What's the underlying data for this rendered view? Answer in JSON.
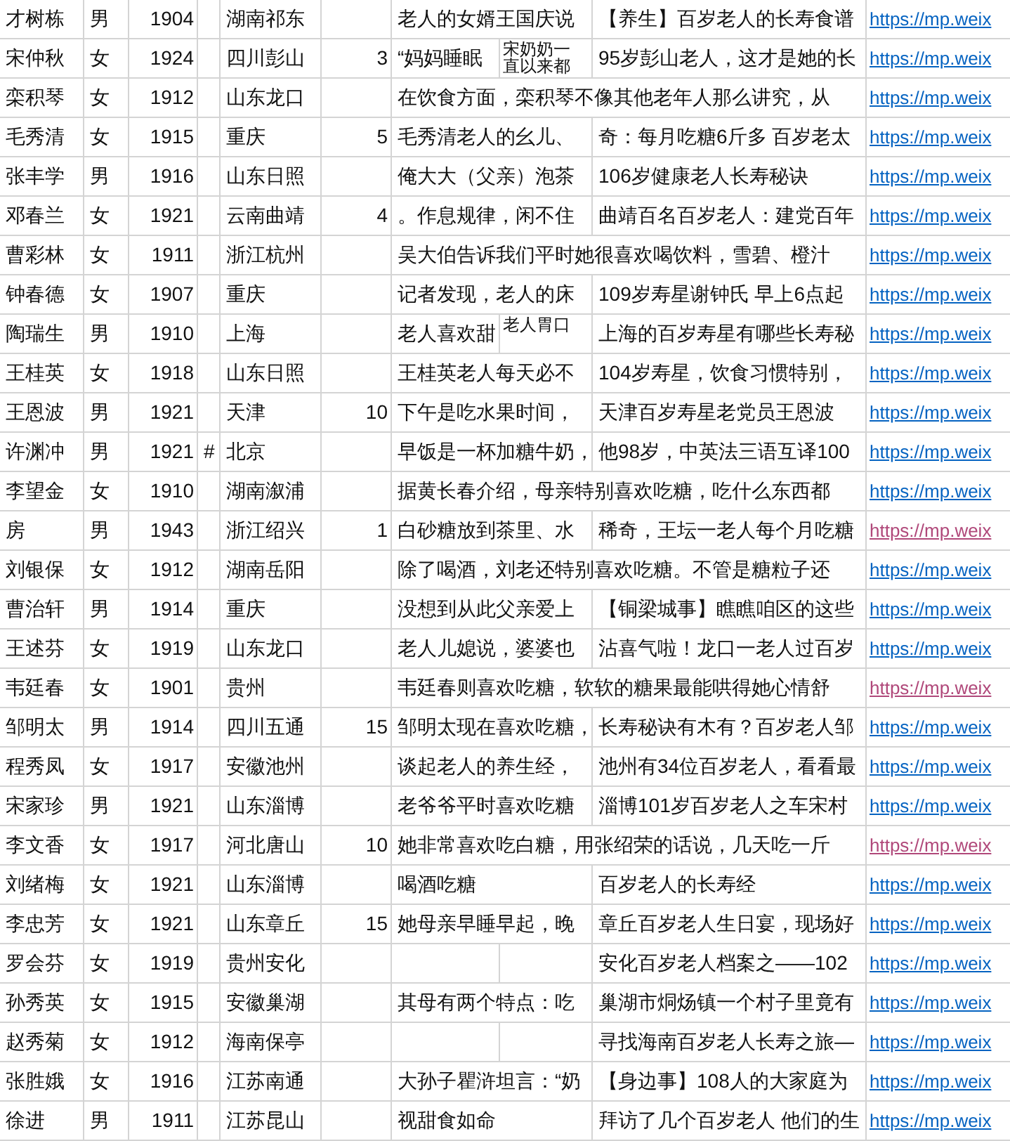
{
  "rows": [
    {
      "column_1": "才树栋",
      "column_2": "男",
      "column_3": "1904",
      "column_5": "湖南祁东",
      "column_7": "老人的女婿王国庆说",
      "column_9": "【养生】百岁老人的长寿食谱",
      "column_10": "https://mp.weix",
      "visited": false
    },
    {
      "column_1": "宋仲秋",
      "column_2": "女",
      "column_3": "1924",
      "column_5": "四川彭山",
      "column_6": "3",
      "column_7": "“妈妈睡眠",
      "column_8": "宋奶奶一直以来都",
      "column_9": "95岁彭山老人，这才是她的长",
      "column_10": "https://mp.weix",
      "visited": false
    },
    {
      "column_1": "栾积琴",
      "column_2": "女",
      "column_3": "1912",
      "column_5": "山东龙口",
      "column_7": "在饮食方面，栾积琴不像其他老年人那么讲究，从",
      "column_10": "https://mp.weix",
      "visited": false
    },
    {
      "column_1": "毛秀清",
      "column_2": "女",
      "column_3": "1915",
      "column_5": "重庆",
      "column_6": "5",
      "column_7": "毛秀清老人的幺儿、",
      "column_9": "奇：每月吃糖6斤多 百岁老太",
      "column_10": "https://mp.weix",
      "visited": false
    },
    {
      "column_1": "张丰学",
      "column_2": "男",
      "column_3": "1916",
      "column_5": "山东日照",
      "column_7": "俺大大（父亲）泡茶",
      "column_9": "106岁健康老人长寿秘诀",
      "column_10": "https://mp.weix",
      "visited": false
    },
    {
      "column_1": "邓春兰",
      "column_2": "女",
      "column_3": "1921",
      "column_5": "云南曲靖",
      "column_6": "4",
      "column_7": "。作息规律，闲不住",
      "column_9": "曲靖百名百岁老人：建党百年",
      "column_10": "https://mp.weix",
      "visited": false
    },
    {
      "column_1": "曹彩林",
      "column_2": "女",
      "column_3": "1911",
      "column_5": "浙江杭州",
      "column_7": "吴大伯告诉我们平时她很喜欢喝饮料，雪碧、橙汁",
      "column_10": "https://mp.weix",
      "visited": false
    },
    {
      "column_1": "钟春德",
      "column_2": "女",
      "column_3": "1907",
      "column_5": "重庆",
      "column_7": "记者发现，老人的床",
      "column_9": "109岁寿星谢钟氏 早上6点起",
      "column_10": "https://mp.weix",
      "visited": false
    },
    {
      "column_1": "陶瑞生",
      "column_2": "男",
      "column_3": "1910",
      "column_5": "上海",
      "column_7": "老人喜欢甜",
      "column_8": "老人胃口",
      "column_9": "上海的百岁寿星有哪些长寿秘",
      "column_10": "https://mp.weix",
      "visited": false
    },
    {
      "column_1": "王桂英",
      "column_2": "女",
      "column_3": "1918",
      "column_5": "山东日照",
      "column_7": "王桂英老人每天必不",
      "column_9": "104岁寿星，饮食习惯特别，",
      "column_10": "https://mp.weix",
      "visited": false
    },
    {
      "column_1": "王恩波",
      "column_2": "男",
      "column_3": "1921",
      "column_5": "天津",
      "column_6": "10",
      "column_7": "下午是吃水果时间，",
      "column_9": "天津百岁寿星老党员王恩波",
      "column_10": "https://mp.weix",
      "visited": false
    },
    {
      "column_1": "许渊冲",
      "column_2": "男",
      "column_3": "1921",
      "column_4": "#",
      "column_5": "北京",
      "column_7": "早饭是一杯加糖牛奶，",
      "column_9": "他98岁，中英法三语互译100",
      "column_10": "https://mp.weix",
      "visited": false
    },
    {
      "column_1": "李望金",
      "column_2": "女",
      "column_3": "1910",
      "column_5": "湖南溆浦",
      "column_7": "据黄长春介绍，母亲特别喜欢吃糖，吃什么东西都",
      "column_10": "https://mp.weix",
      "visited": false
    },
    {
      "column_1": "房",
      "column_2": "男",
      "column_3": "1943",
      "column_5": "浙江绍兴",
      "column_6": "1",
      "column_7": "白砂糖放到茶里、水",
      "column_9": "稀奇，王坛一老人每个月吃糖",
      "column_10": "https://mp.weix",
      "visited": true
    },
    {
      "column_1": "刘银保",
      "column_2": "女",
      "column_3": "1912",
      "column_5": "湖南岳阳",
      "column_7": "除了喝酒，刘老还特别喜欢吃糖。不管是糖粒子还",
      "column_10": "https://mp.weix",
      "visited": false
    },
    {
      "column_1": "曹治轩",
      "column_2": "男",
      "column_3": "1914",
      "column_5": "重庆",
      "column_7": "没想到从此父亲爱上",
      "column_9": "【铜梁城事】瞧瞧咱区的这些",
      "column_10": "https://mp.weix",
      "visited": false
    },
    {
      "column_1": "王述芬",
      "column_2": "女",
      "column_3": "1919",
      "column_5": "山东龙口",
      "column_7": "老人儿媳说，婆婆也",
      "column_9": "沾喜气啦！龙口一老人过百岁",
      "column_10": "https://mp.weix",
      "visited": false
    },
    {
      "column_1": "韦廷春",
      "column_2": "女",
      "column_3": "1901",
      "column_5": "贵州",
      "column_7": "韦廷春则喜欢吃糖，软软的糖果最能哄得她心情舒",
      "column_10": "https://mp.weix",
      "visited": true
    },
    {
      "column_1": "邹明太",
      "column_2": "男",
      "column_3": "1914",
      "column_5": "四川五通",
      "column_6": "15",
      "column_7": "邹明太现在喜欢吃糖，",
      "column_9": "长寿秘诀有木有？百岁老人邹",
      "column_10": "https://mp.weix",
      "visited": false
    },
    {
      "column_1": "程秀凤",
      "column_2": "女",
      "column_3": "1917",
      "column_5": "安徽池州",
      "column_7": "谈起老人的养生经，",
      "column_9": "池州有34位百岁老人，看看最",
      "column_10": "https://mp.weix",
      "visited": false
    },
    {
      "column_1": "宋家珍",
      "column_2": "男",
      "column_3": "1921",
      "column_5": "山东淄博",
      "column_7": "老爷爷平时喜欢吃糖",
      "column_9": "淄博101岁百岁老人之车宋村",
      "column_10": "https://mp.weix",
      "visited": false
    },
    {
      "column_1": "李文香",
      "column_2": "女",
      "column_3": "1917",
      "column_5": "河北唐山",
      "column_6": "10",
      "column_7": "她非常喜欢吃白糖，用张绍荣的话说，几天吃一斤",
      "column_10": "https://mp.weix",
      "visited": true
    },
    {
      "column_1": "刘绪梅",
      "column_2": "女",
      "column_3": "1921",
      "column_5": "山东淄博",
      "column_7": "喝酒吃糖",
      "column_9": "百岁老人的长寿经",
      "column_10": "https://mp.weix",
      "visited": false
    },
    {
      "column_1": "李忠芳",
      "column_2": "女",
      "column_3": "1921",
      "column_5": "山东章丘",
      "column_6": "15",
      "column_7": "她母亲早睡早起，晚",
      "column_9": "章丘百岁老人生日宴，现场好",
      "column_10": "https://mp.weix",
      "visited": false
    },
    {
      "column_1": "罗会芬",
      "column_2": "女",
      "column_3": "1919",
      "column_5": "贵州安化",
      "column_9": "安化百岁老人档案之——102",
      "column_10": "https://mp.weix",
      "visited": false
    },
    {
      "column_1": "孙秀英",
      "column_2": "女",
      "column_3": "1915",
      "column_5": "安徽巢湖",
      "column_7": "其母有两个特点：吃",
      "column_9": "巢湖市烔炀镇一个村子里竟有",
      "column_10": "https://mp.weix",
      "visited": false
    },
    {
      "column_1": "赵秀菊",
      "column_2": "女",
      "column_3": "1912",
      "column_5": "海南保亭",
      "column_9": "寻找海南百岁老人长寿之旅—",
      "column_10": "https://mp.weix",
      "visited": false
    },
    {
      "column_1": "张胜娥",
      "column_2": "女",
      "column_3": "1916",
      "column_5": "江苏南通",
      "column_7": "大孙子瞿浒坦言：“奶",
      "column_9": "【身边事】108人的大家庭为",
      "column_10": "https://mp.weix",
      "visited": false
    },
    {
      "column_1": "徐进",
      "column_2": "男",
      "column_3": "1911",
      "column_5": "江苏昆山",
      "column_7": "视甜食如命",
      "column_9": "拜访了几个百岁老人 他们的生",
      "column_10": "https://mp.weix",
      "visited": false
    }
  ]
}
